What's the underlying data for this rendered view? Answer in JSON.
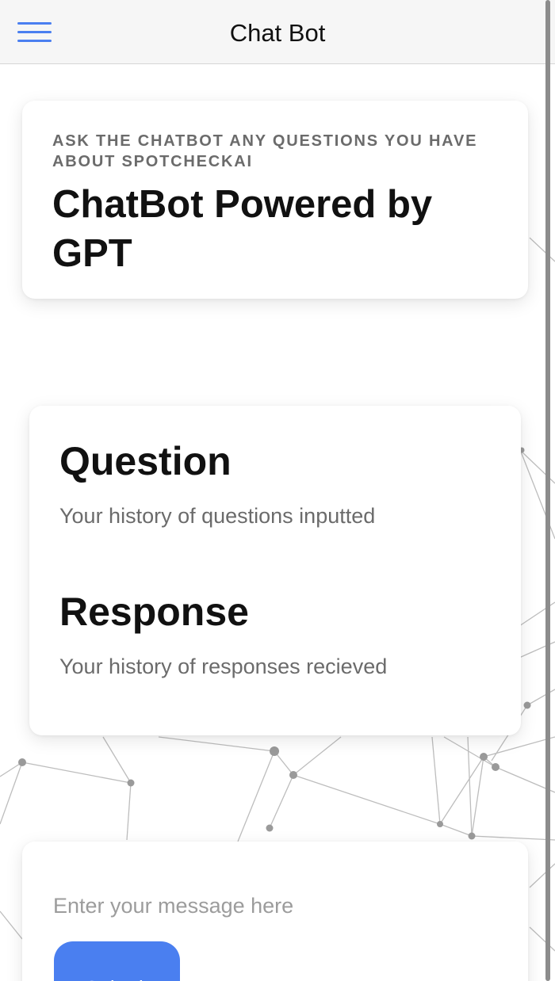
{
  "topbar": {
    "title": "Chat Bot",
    "menu_icon": "hamburger-menu-icon",
    "accent_color": "#4a7ff0"
  },
  "header_card": {
    "eyebrow": "ASK THE CHATBOT ANY QUESTIONS YOU HAVE ABOUT SPOTCHECKAI",
    "title": "ChatBot Powered by GPT"
  },
  "history_card": {
    "question_heading": "Question",
    "question_text": "Your history of questions inputted",
    "response_heading": "Response",
    "response_text": "Your history of responses recieved"
  },
  "input_card": {
    "placeholder": "Enter your message here",
    "submit_label": "Submit",
    "button_color": "#4a7ff0"
  }
}
